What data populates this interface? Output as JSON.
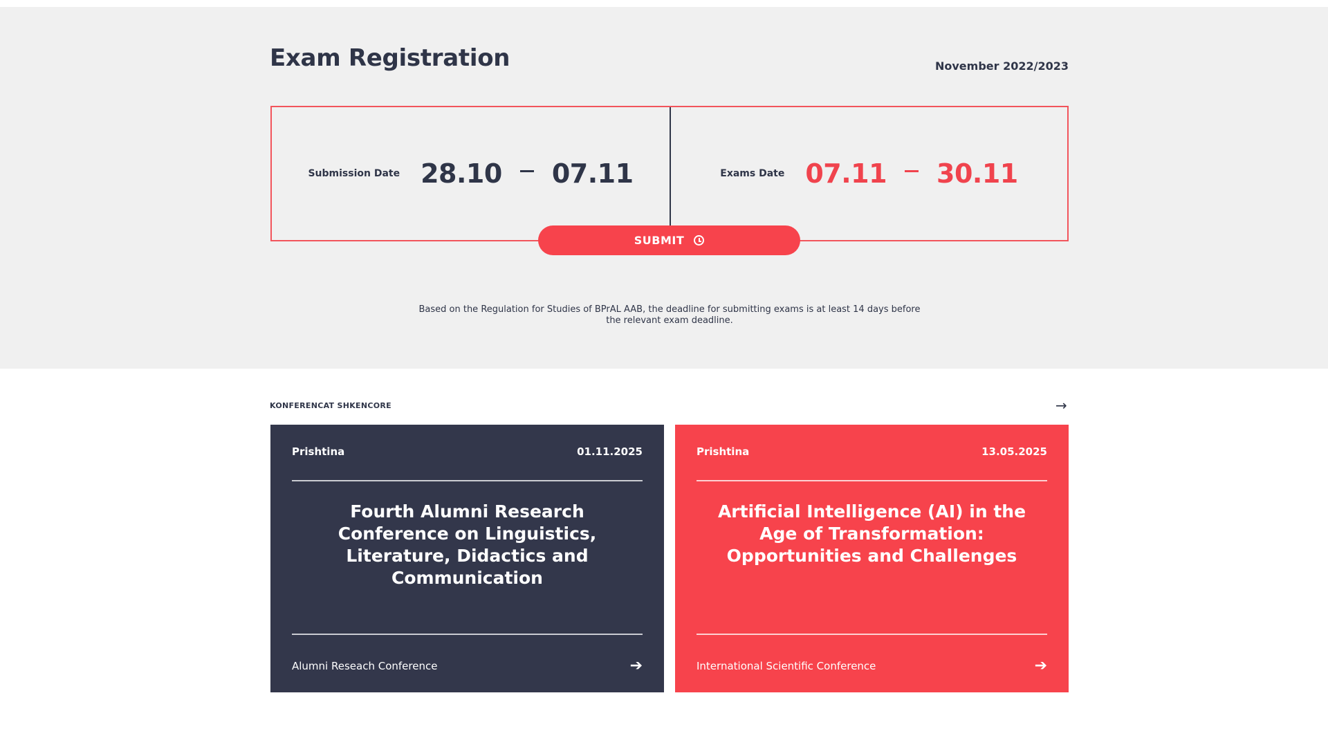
{
  "exam": {
    "title": "Exam Registration",
    "period": "November 2022/2023",
    "submission": {
      "label": "Submission Date",
      "from": "28.10",
      "to": "07.11"
    },
    "exams": {
      "label": "Exams Date",
      "from": "07.11",
      "to": "30.11"
    },
    "submit_label": "SUBMIT",
    "regulation": "Based on the Regulation for Studies of BPrAL AAB, the deadline for submitting exams is at least 14 days before the relevant exam deadline."
  },
  "conferences": {
    "heading": "KONFERENCAT SHKENCORE",
    "arrow_glyph": "→",
    "cards": [
      {
        "location": "Prishtina",
        "date": "01.11.2025",
        "title": "Fourth Alumni Research Conference on Linguistics, Literature, Didactics and Communication",
        "type": "Alumni Reseach Conference",
        "arrow": "➔"
      },
      {
        "location": "Prishtina",
        "date": "13.05.2025",
        "title": "Artificial Intelligence (AI) in the Age of Transformation: Opportunities and Challenges",
        "type": "International Scientific Conference",
        "arrow": "➔"
      }
    ]
  },
  "colors": {
    "accent_red": "#f7434c",
    "dark_navy": "#33374b",
    "band_grey": "#f0f0f0"
  }
}
